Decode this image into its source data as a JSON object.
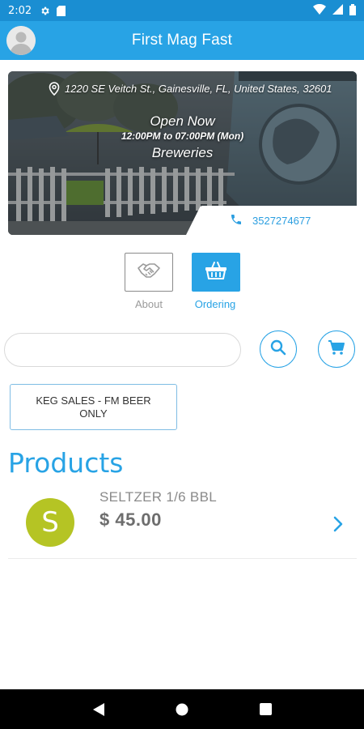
{
  "status_bar": {
    "time": "2:02",
    "icons": [
      "gear-icon",
      "sd-card-icon",
      "wifi-icon",
      "signal-icon",
      "battery-icon"
    ]
  },
  "app_bar": {
    "title": "First Mag Fast"
  },
  "store": {
    "address": "1220 SE Veitch St., Gainesville, FL, United States, 32601",
    "status": "Open Now",
    "hours": "12:00PM to 07:00PM (Mon)",
    "category": "Breweries",
    "phone": "3527274677"
  },
  "tabs": [
    {
      "label": "About",
      "active": false,
      "icon": "handshake-icon"
    },
    {
      "label": "Ordering",
      "active": true,
      "icon": "basket-icon"
    }
  ],
  "search": {
    "value": "",
    "placeholder": ""
  },
  "category_chip": {
    "label": "KEG SALES - FM BEER ONLY"
  },
  "products": {
    "heading": "Products",
    "items": [
      {
        "initial": "S",
        "name": "SELTZER 1/6 BBL",
        "price": "$ 45.00"
      }
    ]
  },
  "colors": {
    "status_bar": "#1a8ed2",
    "accent": "#28a3e5",
    "product_avatar": "#b5c424"
  }
}
